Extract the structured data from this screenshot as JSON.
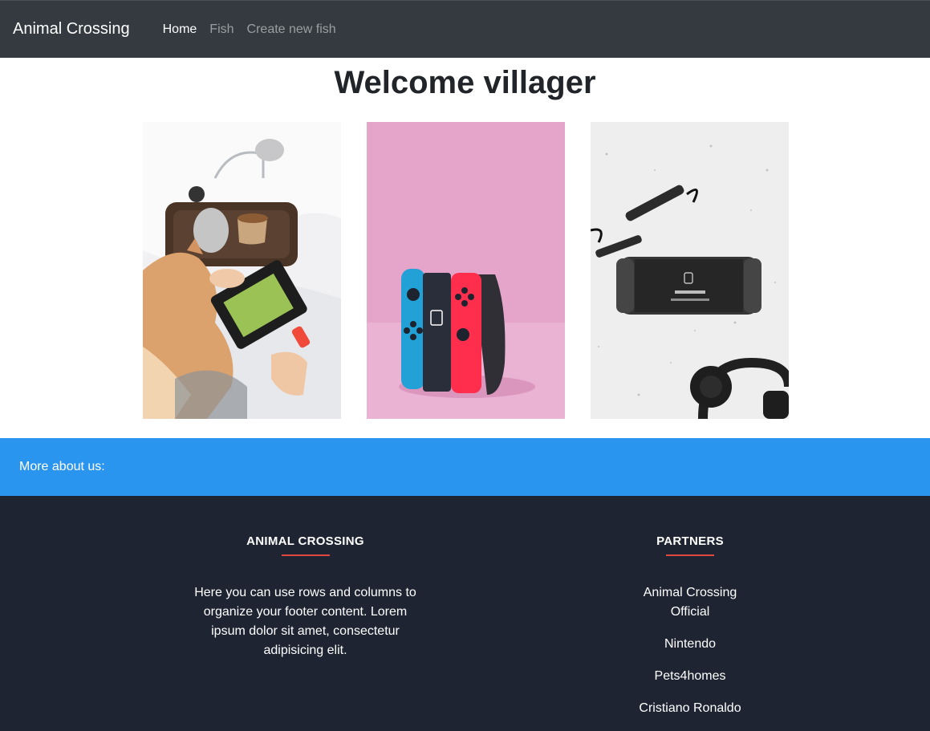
{
  "navbar": {
    "brand": "Animal Crossing",
    "links": [
      {
        "label": "Home",
        "active": true
      },
      {
        "label": "Fish",
        "active": false
      },
      {
        "label": "Create new fish",
        "active": false
      }
    ]
  },
  "main": {
    "title": "Welcome villager"
  },
  "about_band": {
    "label": "More about us:"
  },
  "footer": {
    "left": {
      "heading": "ANIMAL CROSSING",
      "text": "Here you can use rows and columns to organize your footer content. Lorem ipsum dolor sit amet, consectetur adipisicing elit."
    },
    "right": {
      "heading": "PARTNERS",
      "links": [
        "Animal Crossing Official",
        "Nintendo",
        "Pets4homes",
        "Cristiano Ronaldo"
      ]
    }
  },
  "colors": {
    "navbar": "#343a40",
    "band": "#2a95ee",
    "footer": "#1f2433",
    "accent": "#e2483d"
  }
}
